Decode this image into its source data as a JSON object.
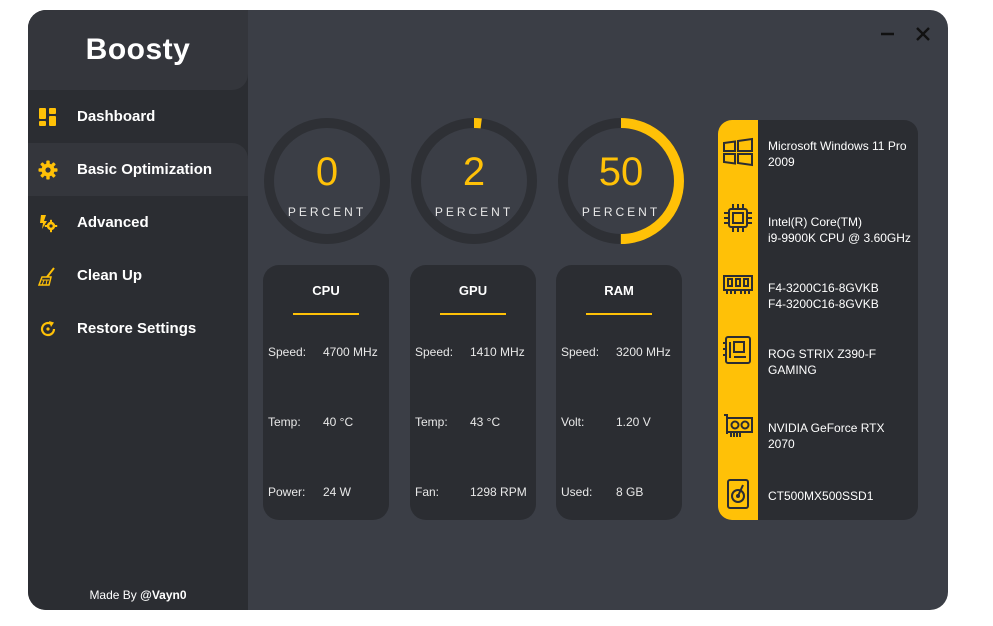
{
  "app": {
    "title": "Boosty"
  },
  "sidebar": {
    "items": [
      {
        "label": "Dashboard",
        "icon": "dashboard-icon",
        "active": true
      },
      {
        "label": "Basic Optimization",
        "icon": "gear-icon"
      },
      {
        "label": "Advanced",
        "icon": "advanced-gear-icon"
      },
      {
        "label": "Clean Up",
        "icon": "broom-icon"
      },
      {
        "label": "Restore Settings",
        "icon": "restore-icon"
      }
    ],
    "footer_prefix": "Made By ",
    "footer_author": "@Vayn0"
  },
  "window_controls": {
    "minimize": "minimize-icon",
    "close": "close-icon"
  },
  "gauges": [
    {
      "value": 0,
      "unit": "PERCENT"
    },
    {
      "value": 2,
      "unit": "PERCENT"
    },
    {
      "value": 50,
      "unit": "PERCENT"
    }
  ],
  "cards": [
    {
      "title": "CPU",
      "rows": [
        {
          "label": "Speed:",
          "value": "4700 MHz"
        },
        {
          "label": "Temp:",
          "value": "40 °C"
        },
        {
          "label": "Power:",
          "value": "24 W"
        }
      ]
    },
    {
      "title": "GPU",
      "rows": [
        {
          "label": "Speed:",
          "value": "1410 MHz"
        },
        {
          "label": "Temp:",
          "value": "43 °C"
        },
        {
          "label": "Fan:",
          "value": "1298 RPM"
        }
      ]
    },
    {
      "title": "RAM",
      "rows": [
        {
          "label": "Speed:",
          "value": "3200 MHz"
        },
        {
          "label": "Volt:",
          "value": "1.20 V"
        },
        {
          "label": "Used:",
          "value": "8 GB"
        }
      ]
    }
  ],
  "system_info": [
    {
      "icon": "windows-icon",
      "line1": "Microsoft Windows 11 Pro",
      "line2": "2009"
    },
    {
      "icon": "cpu-chip-icon",
      "line1": "Intel(R) Core(TM)",
      "line2": "i9-9900K CPU @ 3.60GHz"
    },
    {
      "icon": "ram-module-icon",
      "line1": "F4-3200C16-8GVKB",
      "line2": "F4-3200C16-8GVKB"
    },
    {
      "icon": "motherboard-icon",
      "line1": "ROG STRIX Z390-F",
      "line2": "GAMING"
    },
    {
      "icon": "graphics-card-icon",
      "line1": "NVIDIA GeForce RTX 2070",
      "line2": ""
    },
    {
      "icon": "hard-drive-icon",
      "line1": "CT500MX500SSD1",
      "line2": ""
    }
  ],
  "colors": {
    "accent": "#ffc107",
    "window_bg": "#3b3e46",
    "panel_bg": "#2b2d32",
    "track": "#2e3035"
  }
}
